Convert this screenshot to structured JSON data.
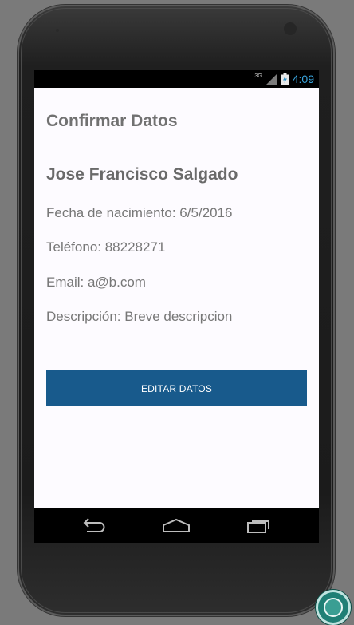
{
  "status_bar": {
    "network_label": "3G",
    "time": "4:09",
    "icons": [
      "signal-icon",
      "battery-charging-icon"
    ]
  },
  "screen": {
    "title": "Confirmar Datos",
    "name": "Jose Francisco Salgado",
    "fields": [
      "Fecha de nacimiento: 6/5/2016",
      "Teléfono: 88228271",
      "Email: a@b.com",
      "Descripción: Breve descripcion"
    ],
    "edit_button_label": "EDITAR DATOS"
  },
  "nav_bar": {
    "icons": [
      "back-icon",
      "home-icon",
      "recent-apps-icon"
    ]
  },
  "colors": {
    "primary_button": "#185a8c",
    "clock": "#3aa7e0",
    "content_background": "#fdfbff"
  }
}
